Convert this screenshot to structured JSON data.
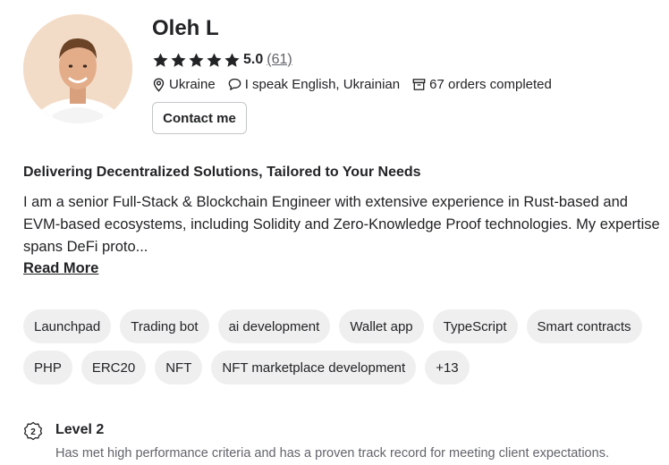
{
  "profile": {
    "name": "Oleh L",
    "rating_value": "5.0",
    "rating_count": "(61)",
    "stars": 5,
    "star_color": "#222325",
    "country": "Ukraine",
    "languages": "I speak English, Ukrainian",
    "orders": "67 orders completed",
    "contact_label": "Contact me"
  },
  "about": {
    "headline": "Delivering Decentralized Solutions, Tailored to Your Needs",
    "description": "I am a senior Full-Stack & Blockchain Engineer with extensive experience in Rust-based and EVM-based ecosystems, including Solidity and Zero-Knowledge Proof technologies. My expertise spans DeFi proto...",
    "read_more_label": "Read More"
  },
  "tags": [
    "Launchpad",
    "Trading bot",
    "ai development",
    "Wallet app",
    "TypeScript",
    "Smart contracts",
    "PHP",
    "ERC20",
    "NFT",
    "NFT marketplace development",
    "+13"
  ],
  "level": {
    "icon": "level-badge-icon",
    "badge_number": "2",
    "title": "Level 2",
    "description": "Has met high performance criteria and has a proven track record for meeting client expectations."
  },
  "icons": {
    "location": "location-pin-icon",
    "language": "speech-bubble-icon",
    "orders": "orders-box-icon",
    "star": "star-icon"
  }
}
